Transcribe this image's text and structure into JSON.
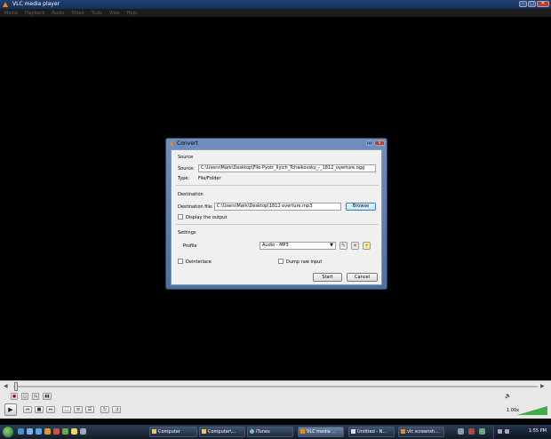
{
  "window": {
    "title": "VLC media player"
  },
  "menu": [
    "Media",
    "Playback",
    "Audio",
    "Video",
    "Tools",
    "View",
    "Help"
  ],
  "dialog": {
    "title": "Convert",
    "source_section": "Source",
    "source_label": "Source:",
    "source_value": "C:\\Users\\Mark\\Desktop\\File-Pyotr_Ilyich_Tchaikovsky_-_1812_overture.ogg",
    "type_label": "Type:",
    "type_value": "File/Folder",
    "destination_section": "Destination",
    "dest_label": "Destination file:",
    "dest_value": "C:\\Users\\Mark\\Desktop\\1812 overture.mp3",
    "browse": "Browse",
    "display_output": "Display the output",
    "settings_section": "Settings",
    "profile_label": "Profile",
    "profile_value": "Audio - MP3",
    "deinterlace": "Deinterlace",
    "dump_raw": "Dump raw input",
    "start": "Start",
    "cancel": "Cancel"
  },
  "player": {
    "speed": "1.00x",
    "volume_percent": 100
  },
  "taskbar": {
    "items": [
      "Computer",
      "Computer\\...",
      "iTunes",
      "VLC media ...",
      "Untitled - N...",
      "vlc screensh..."
    ],
    "active_index": 3,
    "clock": "1:55 PM"
  },
  "colors": {
    "accent": "#f08a00",
    "volume": "#3fae49"
  }
}
